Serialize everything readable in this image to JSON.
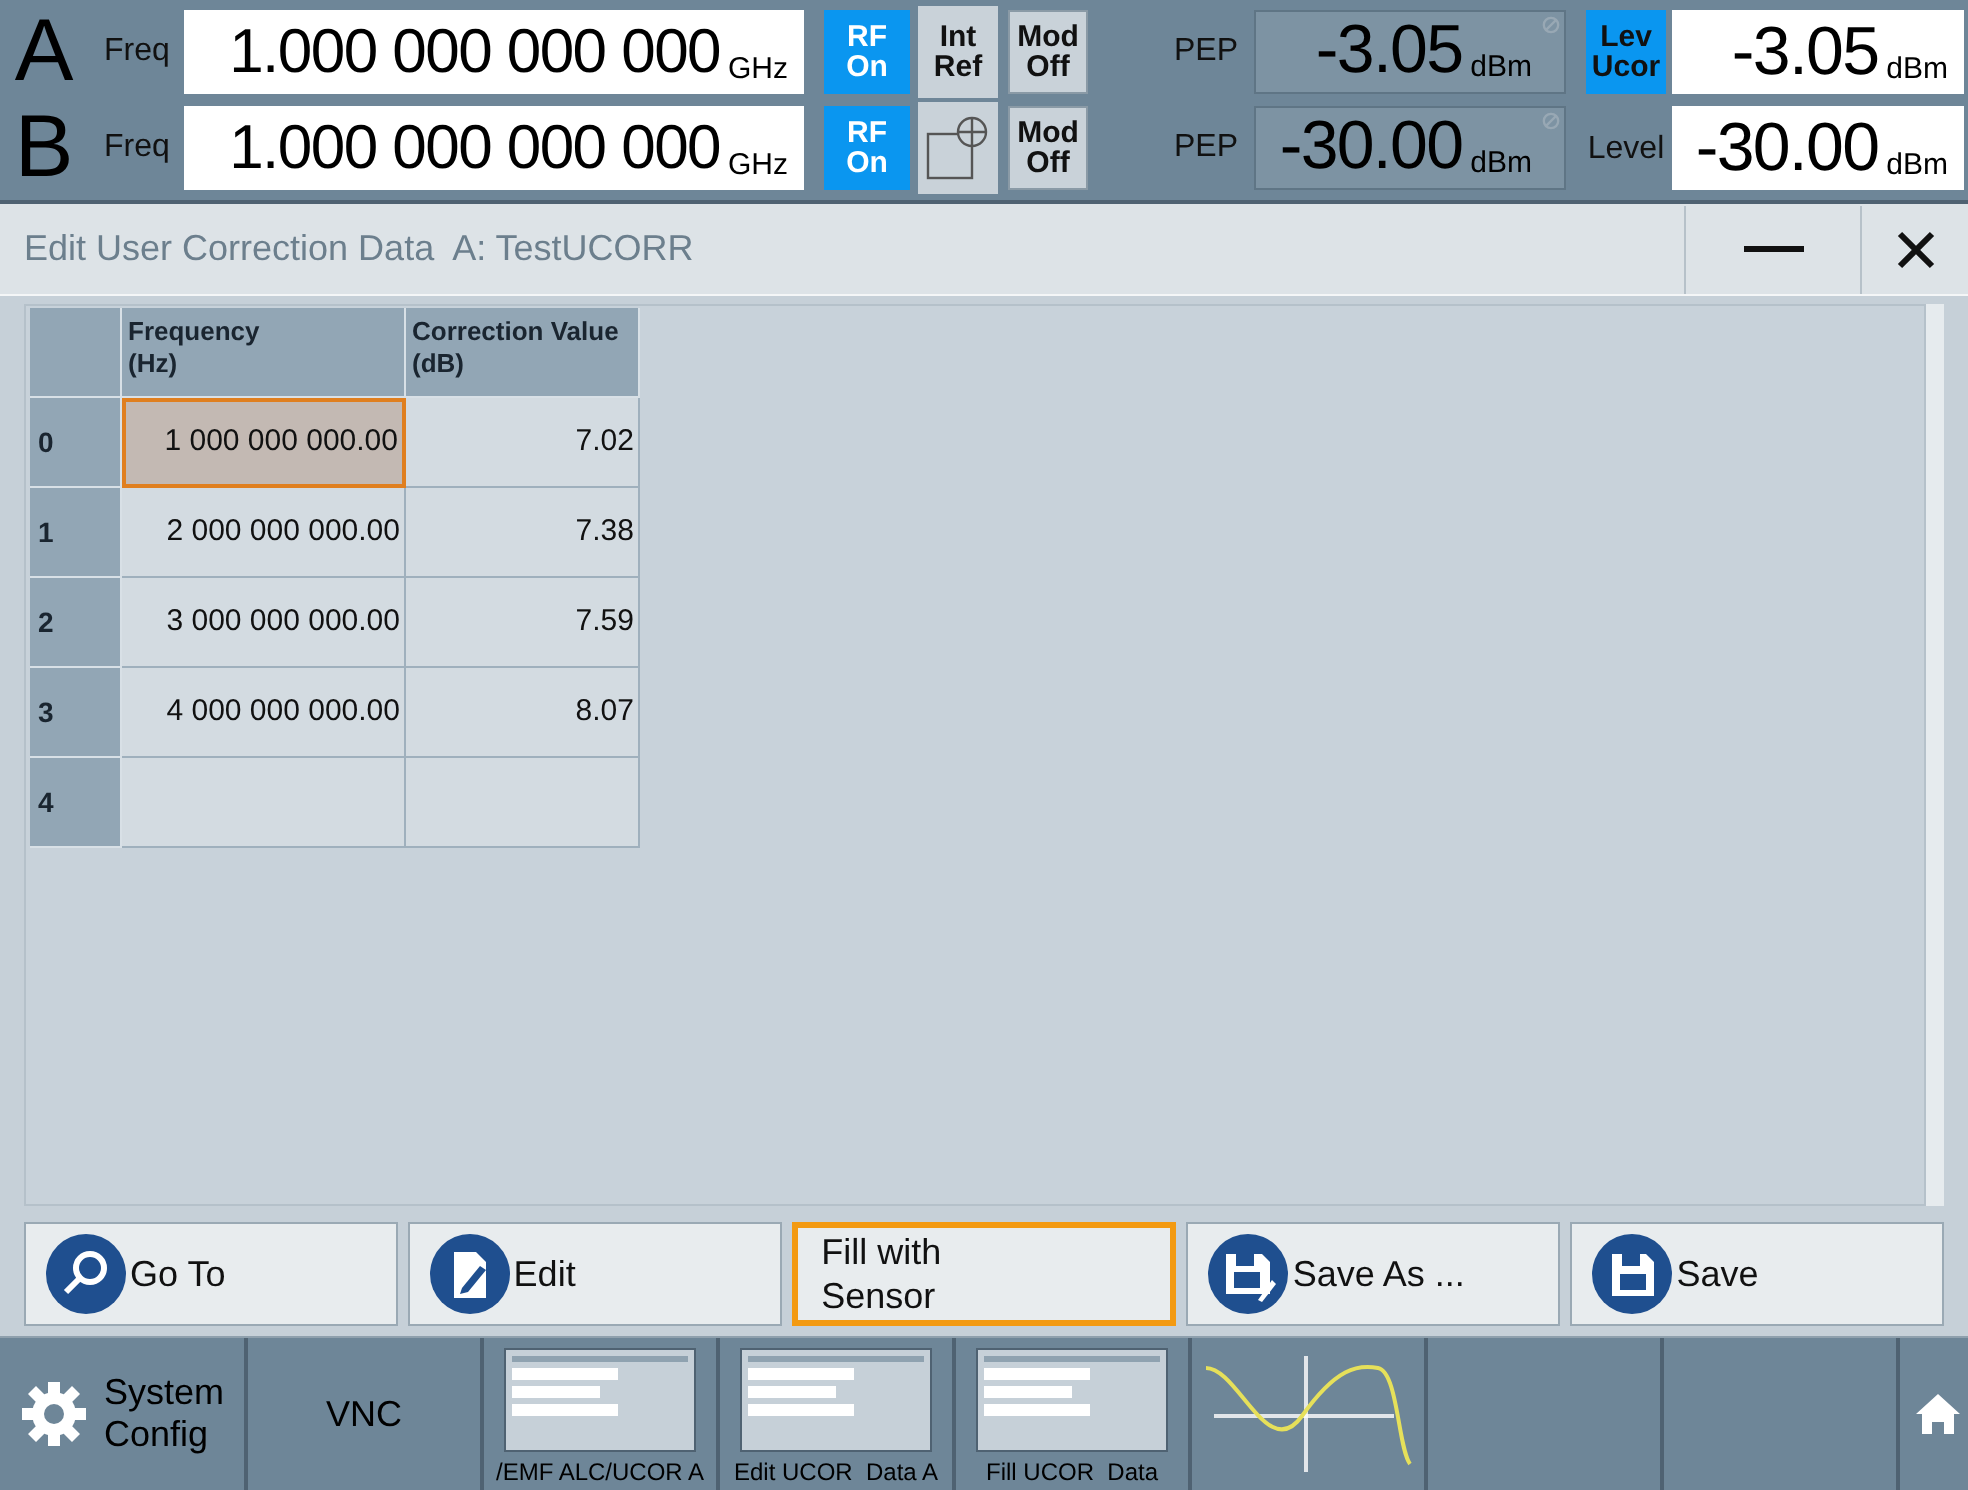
{
  "status_bar": {
    "paths": [
      {
        "letter": "A",
        "freq_label": "Freq",
        "freq_value": "1.000 000 000 000",
        "freq_unit": "GHz",
        "rf": {
          "text": "RF\nOn",
          "on": true
        },
        "ref": {
          "kind": "text",
          "text": "Int\nRef"
        },
        "mod": {
          "text": "Mod\nOff",
          "on": false
        },
        "pep_label": "PEP",
        "pep_value": "-3.05",
        "pep_unit": "dBm",
        "level_label": {
          "text": "Lev\nUcor",
          "highlighted": true
        },
        "level_value": "-3.05",
        "level_unit": "dBm"
      },
      {
        "letter": "B",
        "freq_label": "Freq",
        "freq_value": "1.000 000 000 000",
        "freq_unit": "GHz",
        "rf": {
          "text": "RF\nOn",
          "on": true
        },
        "ref": {
          "kind": "icon"
        },
        "mod": {
          "text": "Mod\nOff",
          "on": false
        },
        "pep_label": "PEP",
        "pep_value": "-30.00",
        "pep_unit": "dBm",
        "level_label": {
          "text": "Level",
          "highlighted": false
        },
        "level_value": "-30.00",
        "level_unit": "dBm"
      }
    ]
  },
  "dialog": {
    "title": "Edit User Correction Data  A: TestUCORR",
    "table": {
      "columns": [
        "Frequency\n(Hz)",
        "Correction Value\n(dB)"
      ],
      "rows": [
        {
          "index": "0",
          "cells": [
            {
              "text": "1 000 000 000.00",
              "focused": true
            },
            {
              "text": "7.02",
              "focused": false
            }
          ]
        },
        {
          "index": "1",
          "cells": [
            {
              "text": "2 000 000 000.00",
              "focused": false
            },
            {
              "text": "7.38",
              "focused": false
            }
          ]
        },
        {
          "index": "2",
          "cells": [
            {
              "text": "3 000 000 000.00",
              "focused": false
            },
            {
              "text": "7.59",
              "focused": false
            }
          ]
        },
        {
          "index": "3",
          "cells": [
            {
              "text": "4 000 000 000.00",
              "focused": false
            },
            {
              "text": "8.07",
              "focused": false
            }
          ]
        },
        {
          "index": "4",
          "cells": [
            {
              "focused": false
            },
            {
              "focused": false
            }
          ]
        }
      ]
    },
    "buttons": [
      {
        "kind": "search",
        "label": "Go To",
        "focused": false
      },
      {
        "kind": "edit",
        "label": "Edit",
        "focused": false
      },
      {
        "kind": "plain",
        "label": "Fill with\nSensor",
        "focused": true
      },
      {
        "kind": "save_as",
        "label": "Save As ...",
        "focused": false
      },
      {
        "kind": "save",
        "label": "Save",
        "focused": false
      }
    ]
  },
  "taskbar": [
    {
      "kind": "setup",
      "label": "System\nConfig"
    },
    {
      "kind": "text",
      "label": "VNC"
    },
    {
      "kind": "thumbnail",
      "label": "/EMF ALC/UCOR A"
    },
    {
      "kind": "thumbnail",
      "label": "Edit UCOR  Data A"
    },
    {
      "kind": "thumbnail",
      "label": "Fill UCOR  Data"
    },
    {
      "kind": "wave"
    },
    {
      "kind": "empty"
    },
    {
      "kind": "empty"
    },
    {
      "kind": "home"
    }
  ]
}
